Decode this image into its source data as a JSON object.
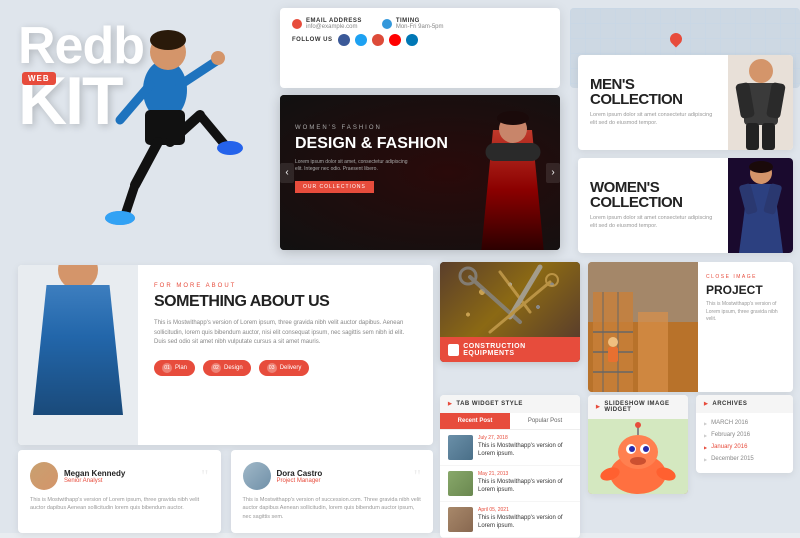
{
  "brand": {
    "name_part1": "Redb",
    "name_part2": "KIT",
    "badge": "WEB"
  },
  "contact": {
    "email_label": "EMAIL ADDRESS",
    "email_value": "info@example.com",
    "timing_label": "TIMING",
    "timing_value": "Mon-Fri 9am-5pm",
    "follow_label": "FOLLOW US"
  },
  "fashion": {
    "subtitle": "WOMEN'S FASHION",
    "title": "DESIGN & FASHION",
    "description": "Lorem ipsum dolor sit amet, consectetur adipiscing elit. Integer nec odio. Praesent libero.",
    "button": "OUR COLLECTIONS"
  },
  "mens": {
    "title_line1": "MEN'S",
    "title_line2": "COLLECTION",
    "description": "Lorem ipsum dolor sit amet consectetur adipiscing elit sed do eiusmod tempor."
  },
  "womens": {
    "title_line1": "WOMEN'S",
    "title_line2": "COLLECTION",
    "description": "Lorem ipsum dolor sit amet consectetur adipiscing elit sed do eiusmod tempor."
  },
  "about": {
    "eyebrow": "FOR MORE ABOUT",
    "title": "SOMETHING ABOUT US",
    "description": "This is Mostwithapp's version of Lorem ipsum, three gravida nibh velit auctor dapibus. Aenean sollicitudin, lorem quis bibendum auctor, nisi elit consequat ipsum, nec sagittis sem nibh id elit. Duis sed odio sit amet nibh vulputate cursus a sit amet mauris.",
    "features": [
      {
        "num": "01",
        "label": "Plan"
      },
      {
        "num": "02",
        "label": "Design"
      },
      {
        "num": "03",
        "label": "Delivery"
      }
    ]
  },
  "construction": {
    "label": "CONSTRUCTION EQUIPMENTS"
  },
  "project": {
    "eyebrow": "CLOSE IMAGE",
    "title": "PROJECT",
    "description": "This is Mostwithapp's version of Lorem ipsum, three gravida nibh velit."
  },
  "team": [
    {
      "name": "Megan Kennedy",
      "role": "Senior Analyst",
      "description": "This is Mostwithapp's version of Lorem ipsum, three gravida nibh velit auctor dapibus Aenean sollicitudin lorem quis bibendum auctor."
    },
    {
      "name": "Dora Castro",
      "role": "Project Manager",
      "description": "This is Mostwithapp's version of succession.com. Three gravida nibh velit auctor dapibus Aenean sollicitudin, lorem quis bibendum auctor ipsum, nec sagittis sem."
    }
  ],
  "tabs": {
    "header": "TAB WIDGET STYLE",
    "buttons": [
      "Recent Post",
      "Popular Post"
    ],
    "posts": [
      {
        "date": "July 27, 2018",
        "title": "This is Mostwithapp's version of Lorem ipsum."
      },
      {
        "date": "May 21, 2013",
        "title": "This is Mostwithapp's version of Lorem ipsum."
      },
      {
        "date": "April 05, 2021",
        "title": "This is Mostwithapp's version of Lorem ipsum."
      }
    ]
  },
  "slideshow": {
    "header": "SLIDESHOW IMAGE WIDGET"
  },
  "archives": {
    "header": "ARCHIVES",
    "items": [
      {
        "label": "MARCH 2016",
        "active": false
      },
      {
        "label": "February 2016",
        "active": false
      },
      {
        "label": "January 2016",
        "active": true
      },
      {
        "label": "December 2015",
        "active": false
      }
    ]
  }
}
